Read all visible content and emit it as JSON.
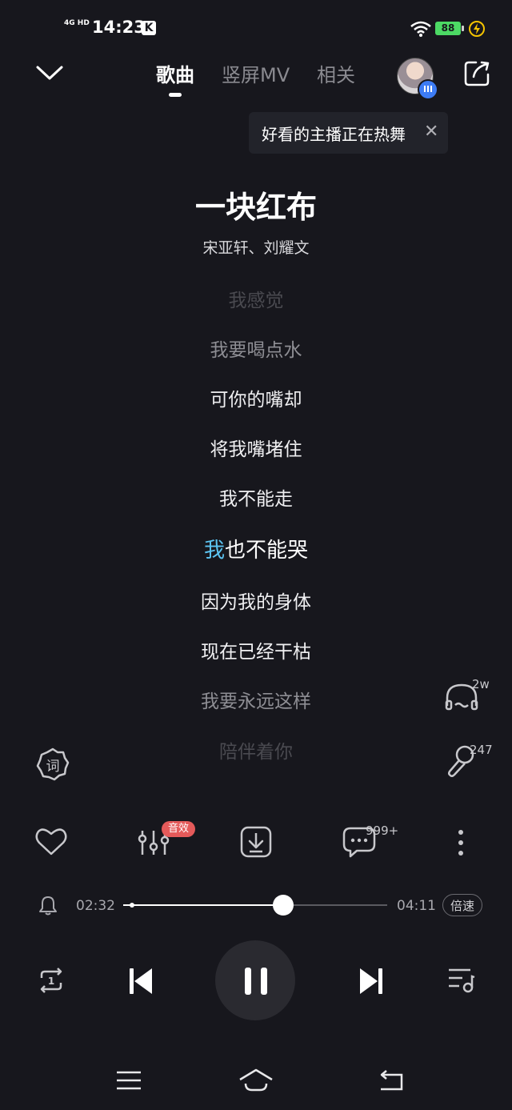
{
  "status_bar": {
    "network": "4G HD",
    "time": "14:23",
    "k_icon": "K",
    "battery": "88"
  },
  "tabs": [
    {
      "label": "歌曲",
      "active": true
    },
    {
      "label": "竖屏MV",
      "active": false
    },
    {
      "label": "相关",
      "active": false
    }
  ],
  "tooltip": {
    "text": "好看的主播正在热舞"
  },
  "song": {
    "title": "一块红布",
    "artist": "宋亚轩、刘耀文"
  },
  "lyrics": [
    {
      "text": "我感觉",
      "state": "faded"
    },
    {
      "text": "我要喝点水",
      "state": "dim"
    },
    {
      "text": "可你的嘴却",
      "state": "normal"
    },
    {
      "text": "将我嘴堵住",
      "state": "normal"
    },
    {
      "text": "我不能走",
      "state": "normal"
    },
    {
      "text_highlight": "我",
      "text_rest": "也不能哭",
      "state": "current"
    },
    {
      "text": "因为我的身体",
      "state": "normal"
    },
    {
      "text": "现在已经干枯",
      "state": "normal"
    },
    {
      "text": "我要永远这样",
      "state": "dim"
    },
    {
      "text": "陪伴着你",
      "state": "faded"
    }
  ],
  "side": {
    "lyric_badge": "词",
    "listen_count": "2w",
    "mic_count": "247"
  },
  "actions": {
    "sound_effect_badge": "音效",
    "comment_count": "999+"
  },
  "progress": {
    "current": "02:32",
    "total": "04:11",
    "fraction": 0.605,
    "speed_label": "倍速"
  },
  "colors": {
    "background": "#17171d",
    "highlight": "#5cc4f2",
    "badge_red": "#e45a5a",
    "battery_green": "#4cd964"
  }
}
